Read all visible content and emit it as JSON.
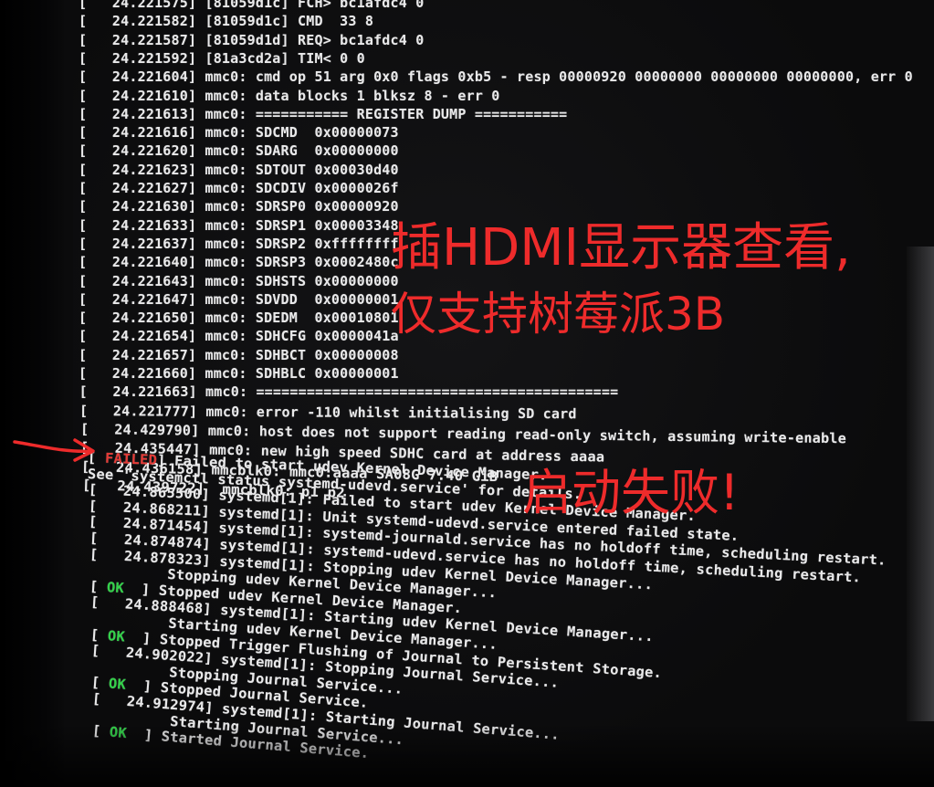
{
  "terminal_lines": [
    {
      "text": "[   24.221575] [81059d1c] FCH> bc1afdc4 0"
    },
    {
      "text": "[   24.221582] [81059d1c] CMD  33 8"
    },
    {
      "text": "[   24.221587] [81059d1d] REQ> bc1afdc4 0"
    },
    {
      "text": "[   24.221592] [81a3cd2a] TIM< 0 0"
    },
    {
      "text": "[   24.221604] mmc0: cmd op 51 arg 0x0 flags 0xb5 - resp 00000920 00000000 00000000 00000000, err 0"
    },
    {
      "text": "[   24.221610] mmc0: data blocks 1 blksz 8 - err 0"
    },
    {
      "text": "[   24.221613] mmc0: =========== REGISTER DUMP ==========="
    },
    {
      "text": "[   24.221616] mmc0: SDCMD  0x00000073"
    },
    {
      "text": "[   24.221620] mmc0: SDARG  0x00000000"
    },
    {
      "text": "[   24.221623] mmc0: SDTOUT 0x00030d40"
    },
    {
      "text": "[   24.221627] mmc0: SDCDIV 0x0000026f"
    },
    {
      "text": "[   24.221630] mmc0: SDRSP0 0x00000920"
    },
    {
      "text": "[   24.221633] mmc0: SDRSP1 0x00003348"
    },
    {
      "text": "[   24.221637] mmc0: SDRSP2 0xffffffff"
    },
    {
      "text": "[   24.221640] mmc0: SDRSP3 0x0002480c"
    },
    {
      "text": "[   24.221643] mmc0: SDHSTS 0x00000000"
    },
    {
      "text": "[   24.221647] mmc0: SDVDD  0x00000001"
    },
    {
      "text": "[   24.221650] mmc0: SDEDM  0x00010801"
    },
    {
      "text": "[   24.221654] mmc0: SDHCFG 0x0000041a"
    },
    {
      "text": "[   24.221657] mmc0: SDHBCT 0x00000008"
    },
    {
      "text": "[   24.221660] mmc0: SDHBLC 0x00000001"
    },
    {
      "text": "[   24.221663] mmc0: ==========================================="
    },
    {
      "text": "[   24.221777] mmc0: error -110 whilst initialising SD card"
    },
    {
      "text": "[   24.429790] mmc0: host does not support reading read-only switch, assuming write-enable"
    },
    {
      "text": "[   24.435447] mmc0: new high speed SDHC card at address aaaa"
    },
    {
      "text": "[   24.436158] mmcblk0: mmc0:aaaa SA08G 7.40 GiB"
    },
    {
      "text": "[   24.439722]  mmcblk0: p1 p2"
    },
    {
      "tag": "FAILED",
      "text": "] Failed to start udev Kernel Device Manager."
    },
    {
      "text": "See 'systemctl status systemd-udevd.service' for details."
    },
    {
      "text": "[   24.865500] systemd[1]: Failed to start udev Kernel Device Manager."
    },
    {
      "text": "[   24.868211] systemd[1]: Unit systemd-udevd.service entered failed state."
    },
    {
      "text": "[   24.871454] systemd[1]: systemd-journald.service has no holdoff time, scheduling restart."
    },
    {
      "text": "[   24.874874] systemd[1]: systemd-udevd.service has no holdoff time, scheduling restart."
    },
    {
      "text": "[   24.878323] systemd[1]: Stopping udev Kernel Device Manager..."
    },
    {
      "text": "         Stopping udev Kernel Device Manager..."
    },
    {
      "tag": "OK",
      "text": "  ] Stopped udev Kernel Device Manager."
    },
    {
      "text": "[   24.888468] systemd[1]: Starting udev Kernel Device Manager..."
    },
    {
      "text": "         Starting udev Kernel Device Manager..."
    },
    {
      "tag": "OK",
      "text": "  ] Stopped Trigger Flushing of Journal to Persistent Storage."
    },
    {
      "text": "[   24.902022] systemd[1]: Stopping Journal Service..."
    },
    {
      "text": "         Stopping Journal Service..."
    },
    {
      "tag": "OK",
      "text": "  ] Stopped Journal Service."
    },
    {
      "text": "[   24.912974] systemd[1]: Starting Journal Service..."
    },
    {
      "text": "         Starting Journal Service..."
    },
    {
      "tag": "OK",
      "text": "  ] Started Journal Service."
    }
  ],
  "annotations": {
    "hdmi_note_line1": "插HDMI显示器查看,",
    "hdmi_note_line2": "仅支持树莓派3B",
    "boot_failed_note": "启动失败!"
  },
  "colors": {
    "terminal_text": "#e9e9ea",
    "ok": "#33d24a",
    "failed": "#e63a36",
    "annotation": "#ee2b2b"
  }
}
